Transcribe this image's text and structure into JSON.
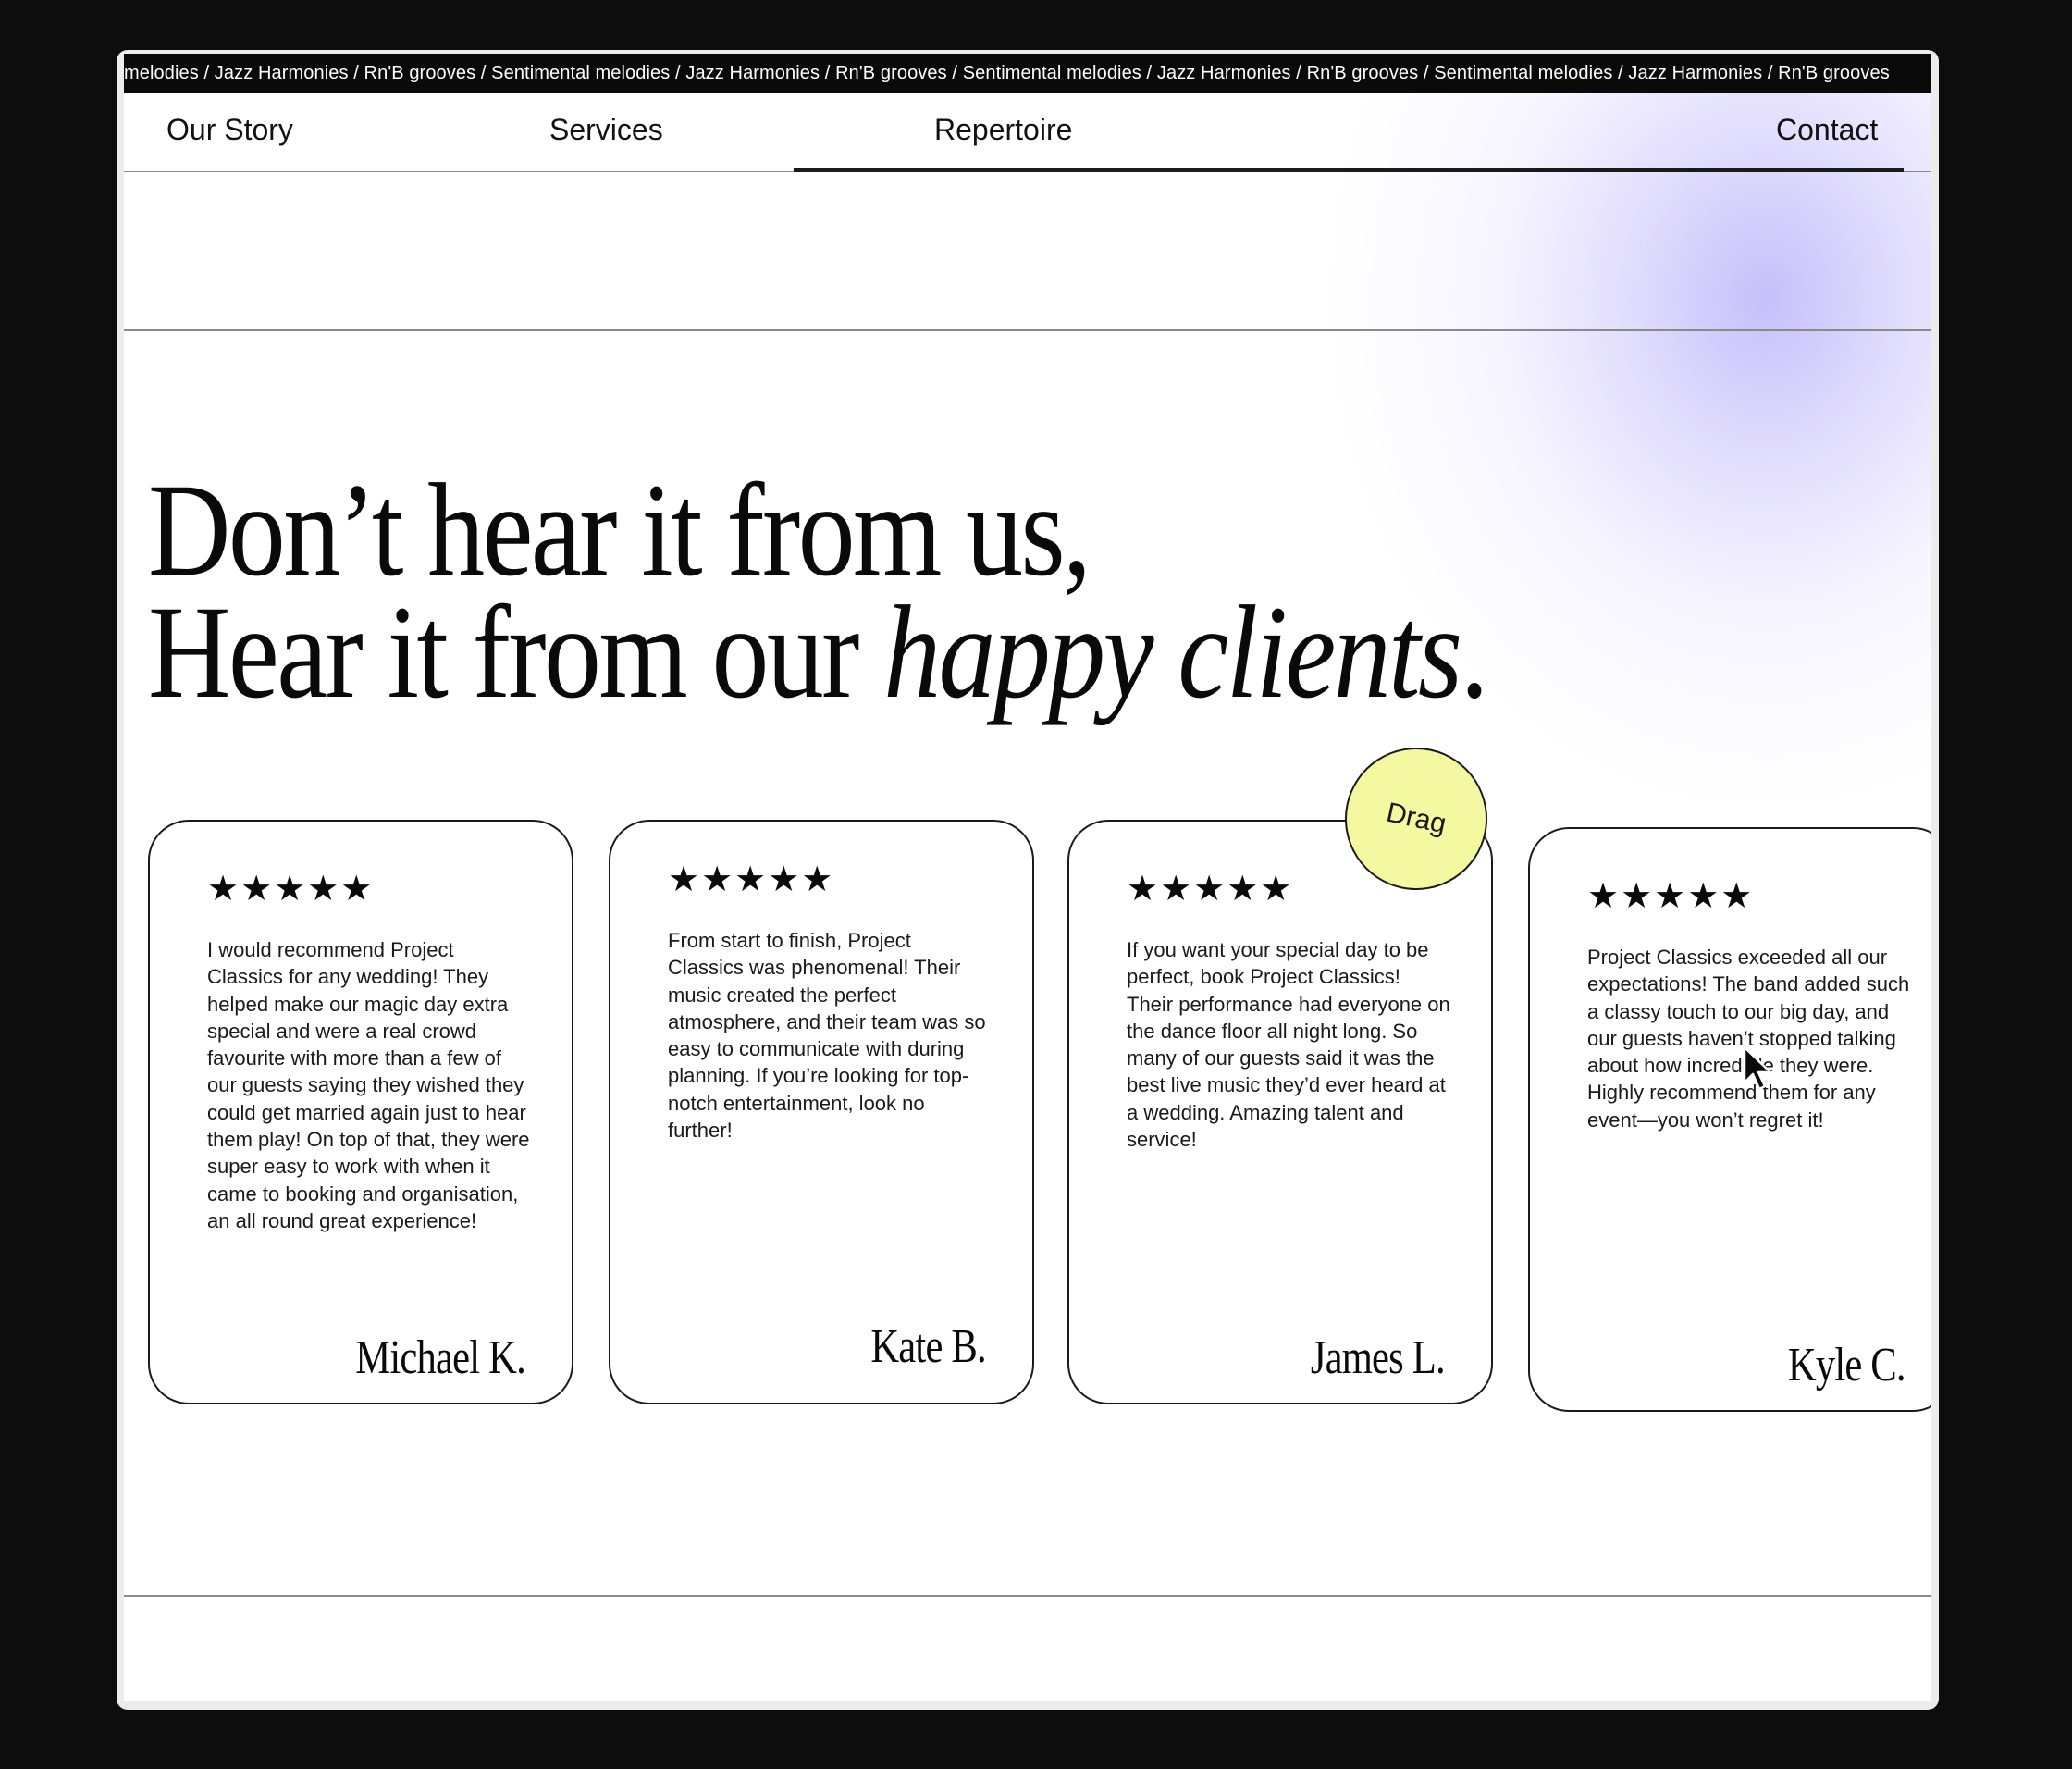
{
  "marquee": {
    "text": "melodies / Jazz Harmonies / Rn'B grooves / Sentimental melodies / Jazz Harmonies / Rn'B grooves / Sentimental melodies / Jazz Harmonies / Rn'B grooves / Sentimental melodies / Jazz Harmonies / Rn'B grooves"
  },
  "nav": {
    "our_story": "Our Story",
    "services": "Services",
    "repertoire": "Repertoire",
    "contact": "Contact"
  },
  "headline": {
    "line1": "Don’t hear it from us,",
    "line2_prefix": "Hear it from our ",
    "line2_emphasis": "happy clients",
    "line2_suffix": "."
  },
  "drag_label": "Drag",
  "reviews": [
    {
      "stars": "★★★★★",
      "text": "I would recommend Project Classics for any wedding! They helped make our magic day extra special and were a real crowd favourite with more than a few of our guests saying they wished they could get married again just to hear them play! On top of that, they were super easy to work with when it came to booking and organisation, an all round great experience!",
      "author": "Michael K."
    },
    {
      "stars": "★★★★★",
      "text": "From start to finish, Project Classics was phenomenal! Their music created the perfect atmosphere, and their team was so easy to communicate with during planning. If you’re looking for top-notch entertainment, look no further!",
      "author": "Kate B."
    },
    {
      "stars": "★★★★★",
      "text": "If you want your special day to be perfect, book Project Classics! Their performance had everyone on the dance floor all night long. So many of our guests said it was the best live music they’d ever heard at a wedding. Amazing talent and service!",
      "author": "James L."
    },
    {
      "stars": "★★★★★",
      "text": "Project Classics exceeded all our expectations! The band added such a classy touch to our big day, and our guests haven’t stopped talking about how incredible they were. Highly recommend them for any event—you won’t regret it!",
      "author": "Kyle C."
    }
  ],
  "icons": {
    "cursor": "mouse-pointer-icon",
    "star": "star-icon"
  },
  "colors": {
    "accent_lavender": "#c4bcfa",
    "drag_yellow": "#f4f8a0",
    "ink": "#0a0a0a"
  }
}
